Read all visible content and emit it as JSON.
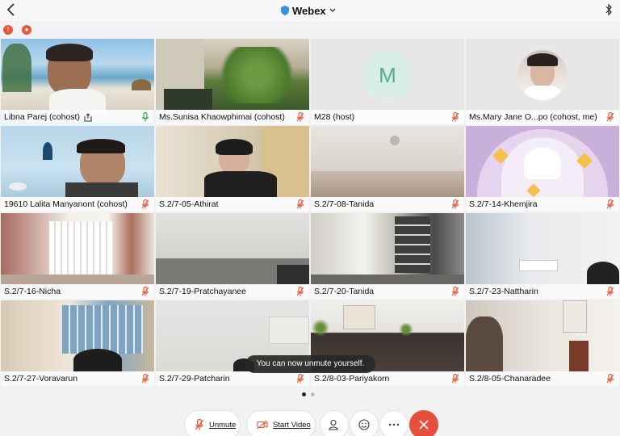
{
  "app": {
    "title": "Webex"
  },
  "participants": [
    {
      "name": "Libna Parej (cohost)"
    },
    {
      "name": "Ms.Sunisa Khaowphimai (cohost)"
    },
    {
      "name": "M28 (host)",
      "avatar_letter": "M"
    },
    {
      "name": "Ms.Mary Jane O...po (cohost, me)"
    },
    {
      "name": "19610 Lalita Manyanont (cohost)"
    },
    {
      "name": "S.2/7-05-Athirat"
    },
    {
      "name": "S.2/7-08-Tanida"
    },
    {
      "name": "S.2/7-14-Khemjira"
    },
    {
      "name": "S.2/7-16-Nicha"
    },
    {
      "name": "S.2/7-19-Pratchayanee"
    },
    {
      "name": "S.2/7-20-Tanida"
    },
    {
      "name": "S.2/7-23-Nattharin"
    },
    {
      "name": "S.2/7-27-Voravarun"
    },
    {
      "name": "S.2/7-29-Patcharin"
    },
    {
      "name": "S.2/8-03-Pariyakorn"
    },
    {
      "name": "S.2/8-05-Chanaradee"
    }
  ],
  "toast": "You can now unmute yourself.",
  "controls": {
    "unmute": "Unmute",
    "start_video": "Start Video"
  },
  "colors": {
    "end_call": "#e54f3c",
    "active_border": "#3fa9f5",
    "muted_mic": "#e45a3b",
    "unmuted_mic": "#2fa84f"
  }
}
